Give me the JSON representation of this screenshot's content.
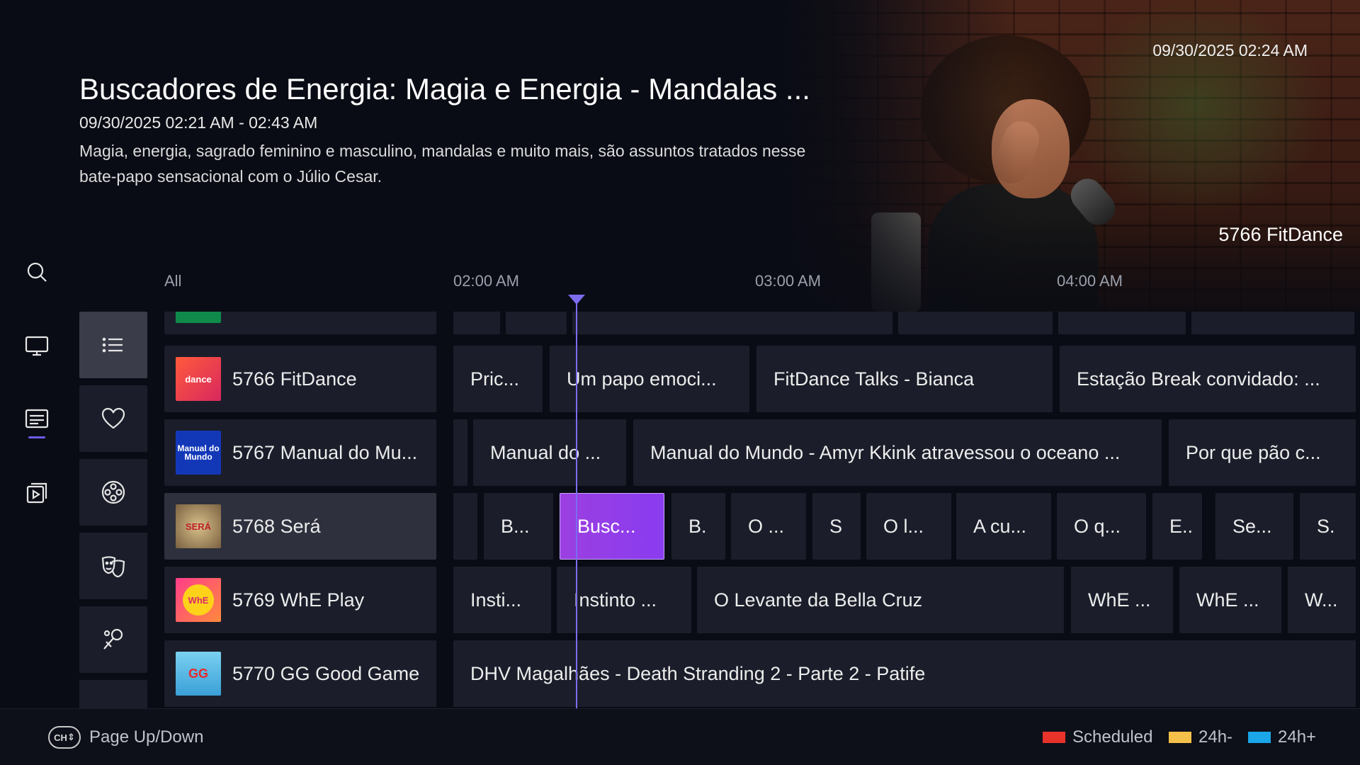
{
  "program": {
    "title": "Buscadores de Energia: Magia e Energia - Mandalas ...",
    "time": "09/30/2025 02:21 AM - 02:43 AM",
    "description": "Magia, energia, sagrado feminino e masculino, mandalas e muito mais, são assuntos tratados nesse bate-papo sensacional com o Júlio Cesar."
  },
  "clock": "09/30/2025 02:24 AM",
  "preview": {
    "channel": "5766 FitDance"
  },
  "nav": [
    {
      "name": "search-icon"
    },
    {
      "name": "tv-icon"
    },
    {
      "name": "guide-icon",
      "active": true
    },
    {
      "name": "playlist-icon"
    }
  ],
  "timeline": {
    "filter": "All",
    "times": [
      "02:00 AM",
      "03:00 AM",
      "04:00 AM"
    ]
  },
  "categories": [
    {
      "name": "list-icon",
      "active": true
    },
    {
      "name": "heart-icon"
    },
    {
      "name": "film-reel-icon"
    },
    {
      "name": "theater-masks-icon"
    },
    {
      "name": "sports-icon"
    }
  ],
  "channels": [
    {
      "name": "5766 FitDance",
      "logo_text": "dance",
      "logo_color": "#e8345c",
      "programs": [
        "Pric...",
        "Um papo emoci...",
        "FitDance Talks - Bianca",
        "Estação Break convidado: ..."
      ]
    },
    {
      "name": "5767 Manual do Mu...",
      "logo_text": "Manual do Mundo",
      "logo_color": "#1238b8",
      "programs": [
        "",
        "Manual do ...",
        "Manual do Mundo - Amyr Kkink atravessou o oceano ...",
        "Por que pão c..."
      ]
    },
    {
      "name": "5768 Será",
      "logo_text": "SERÁ",
      "logo_color": "#a0865a",
      "focused": true,
      "programs": [
        "",
        "B...",
        "Busc...",
        "B.",
        "O ...",
        "S",
        "O l...",
        "A cu...",
        "O q...",
        "E..",
        "Se...",
        "S."
      ]
    },
    {
      "name": "5769 WhE Play",
      "logo_text": "WhE",
      "logo_color": "#f03a8a",
      "programs": [
        "Insti...",
        "Instinto ...",
        "O Levante da Bella Cruz",
        "WhE ...",
        "WhE ...",
        "W..."
      ]
    },
    {
      "name": "5770 GG Good Game",
      "logo_text": "GG",
      "logo_color": "#5ab8e8",
      "programs": [
        "DHV Magalhães - Death Stranding 2 - Parte 2 - Patife"
      ]
    }
  ],
  "footer": {
    "hint": "Page Up/Down",
    "ch_key": "CH",
    "legend": [
      {
        "label": "Scheduled",
        "color": "#e8332a"
      },
      {
        "label": "24h-",
        "color": "#f5c04a"
      },
      {
        "label": "24h+",
        "color": "#1aa6e8"
      }
    ]
  }
}
